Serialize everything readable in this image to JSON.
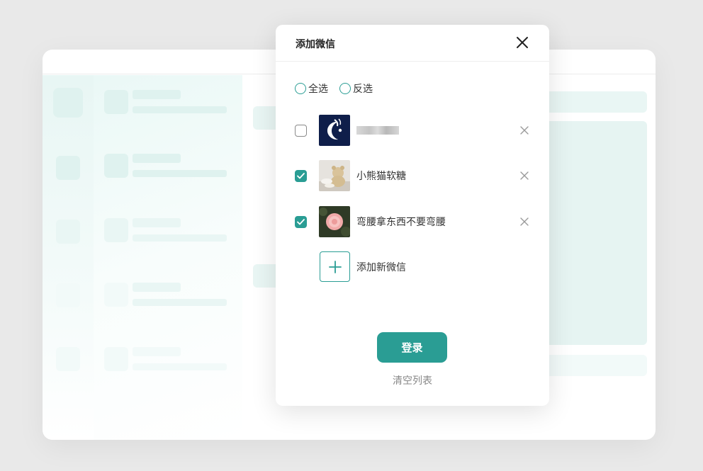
{
  "dialog": {
    "title": "添加微信",
    "select_all_label": "全选",
    "invert_label": "反选",
    "accounts": [
      {
        "name": "",
        "checked": false,
        "avatar": "moon-logo-avatar"
      },
      {
        "name": "小熊猫软糖",
        "checked": true,
        "avatar": "teddy-bear-photo-avatar"
      },
      {
        "name": "弯腰拿东西不要弯腰",
        "checked": true,
        "avatar": "pink-rose-photo-avatar"
      }
    ],
    "add_label": "添加新微信",
    "login_label": "登录",
    "clear_label": "清空列表"
  },
  "colors": {
    "accent": "#2a9d94",
    "background": "#e9e9e9",
    "skeleton": "#dff2ef"
  }
}
